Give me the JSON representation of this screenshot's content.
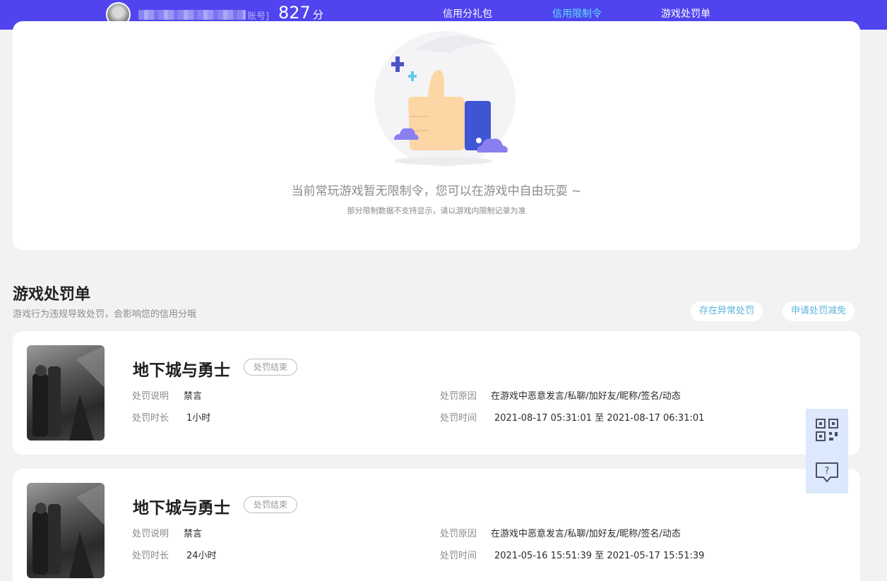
{
  "header": {
    "account_suffix": "账号]",
    "score_value": "827",
    "score_unit": "分",
    "nav": [
      {
        "label": "信用分礼包",
        "active": false
      },
      {
        "label": "信用限制令",
        "active": true
      },
      {
        "label": "游戏处罚单",
        "active": false
      }
    ]
  },
  "restriction": {
    "empty_message": "当前常玩游戏暂无限制令，您可以在游戏中自由玩耍 ~",
    "empty_note": "部分限制数据不支持显示，请以游戏内限制记录为准"
  },
  "penalties_section": {
    "title": "游戏处罚单",
    "subtitle": "游戏行为违规导致处罚，会影响您的信用分哦",
    "abnormal_button": "存在异常处罚",
    "reduction_button": "申请处罚减免"
  },
  "penalty_labels": {
    "description": "处罚说明",
    "duration": "处罚时长",
    "reason": "处罚原因",
    "time": "处罚时间"
  },
  "penalties": [
    {
      "game": "地下城与勇士",
      "status": "处罚结束",
      "description": "禁言",
      "duration": "1小时",
      "reason": "在游戏中恶意发言/私聊/加好友/昵称/签名/动态",
      "time": "2021-08-17 05:31:01 至 2021-08-17 06:31:01"
    },
    {
      "game": "地下城与勇士",
      "status": "处罚结束",
      "description": "禁言",
      "duration": "24小时",
      "reason": "在游戏中恶意发言/私聊/加好友/昵称/签名/动态",
      "time": "2021-05-16 15:51:39 至 2021-05-17 15:51:39"
    }
  ],
  "floating_tools": [
    {
      "icon": "qr-code-icon"
    },
    {
      "icon": "help-chat-icon"
    }
  ],
  "colors": {
    "topbar": "#4f44ee",
    "active_nav": "#5ee0ff",
    "pill_text": "#5ab4dc",
    "float_bg": "#dce8fb"
  }
}
